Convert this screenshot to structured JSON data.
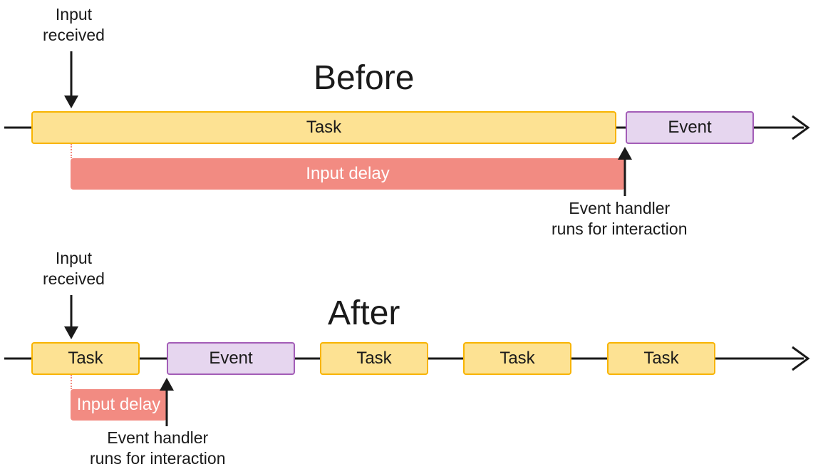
{
  "before": {
    "title": "Before",
    "input_received": "Input\nreceived",
    "task": "Task",
    "event": "Event",
    "input_delay": "Input delay",
    "handler_caption": "Event handler\nruns for interaction"
  },
  "after": {
    "title": "After",
    "input_received": "Input\nreceived",
    "tasks": [
      "Task",
      "Task",
      "Task",
      "Task"
    ],
    "event": "Event",
    "input_delay": "Input delay",
    "handler_caption": "Event handler\nruns for interaction"
  },
  "colors": {
    "task_fill": "#fde293",
    "task_border": "#f8b400",
    "event_fill": "#e6d6ef",
    "event_border": "#a35db7",
    "delay_fill": "#f28b82",
    "text": "#1a1a1a"
  }
}
